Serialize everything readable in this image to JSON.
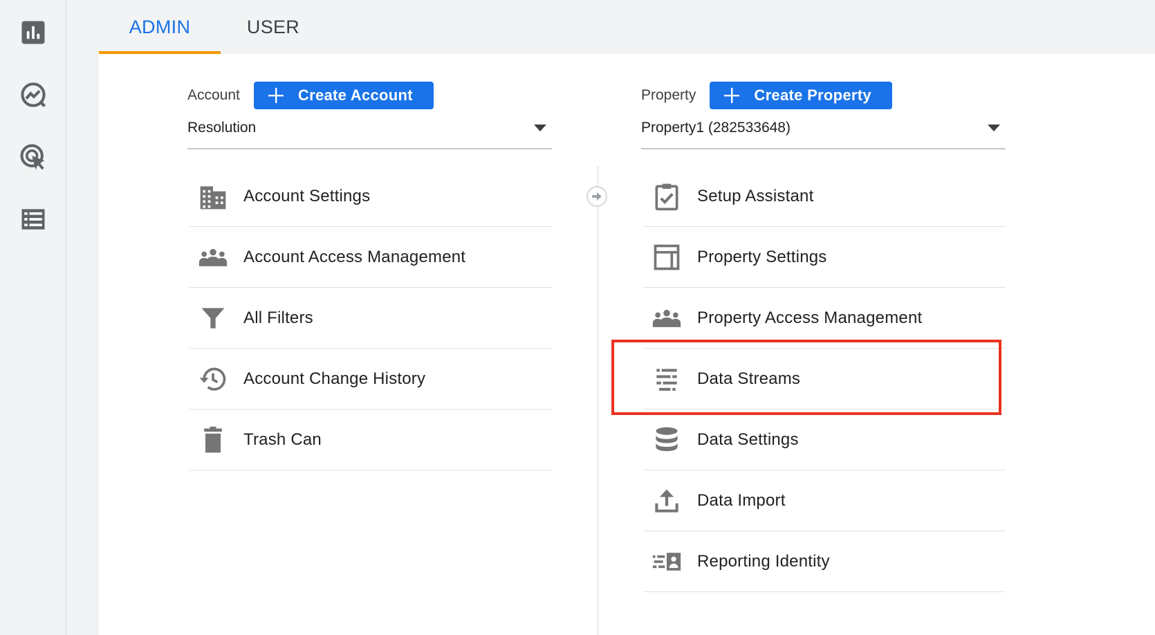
{
  "nav_rail": {
    "items": [
      {
        "icon": "bar-chart-icon"
      },
      {
        "icon": "explore-trend-icon"
      },
      {
        "icon": "advertising-cursor-icon"
      },
      {
        "icon": "list-configure-icon"
      }
    ]
  },
  "tabs": {
    "admin": "ADMIN",
    "user": "USER",
    "active": "ADMIN",
    "accent_color": "#f29900"
  },
  "account": {
    "label": "Account",
    "create_button": "Create Account",
    "selected": "Resolution",
    "menu": [
      {
        "label": "Account Settings",
        "icon": "building-icon"
      },
      {
        "label": "Account Access Management",
        "icon": "people-icon"
      },
      {
        "label": "All Filters",
        "icon": "filter-icon"
      },
      {
        "label": "Account Change History",
        "icon": "history-icon"
      },
      {
        "label": "Trash Can",
        "icon": "trash-icon"
      }
    ]
  },
  "property": {
    "label": "Property",
    "create_button": "Create Property",
    "selected": "Property1 (282533648)",
    "menu": [
      {
        "label": "Setup Assistant",
        "icon": "checklist-icon"
      },
      {
        "label": "Property Settings",
        "icon": "layout-icon"
      },
      {
        "label": "Property Access Management",
        "icon": "people-icon"
      },
      {
        "label": "Data Streams",
        "icon": "data-streams-icon",
        "highlighted": true
      },
      {
        "label": "Data Settings",
        "icon": "database-icon"
      },
      {
        "label": "Data Import",
        "icon": "upload-icon"
      },
      {
        "label": "Reporting Identity",
        "icon": "reporting-identity-icon"
      }
    ]
  },
  "colors": {
    "primary": "#1a73e8",
    "highlight": "#ea3323",
    "icon": "#5f6368"
  }
}
